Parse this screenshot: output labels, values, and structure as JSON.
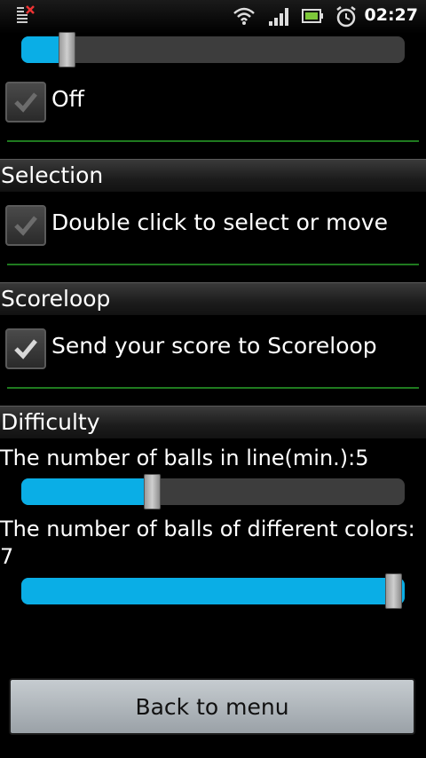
{
  "statusbar": {
    "time": "02:27",
    "icons": [
      "notification-icon",
      "wifi-icon",
      "signal-icon",
      "battery-icon",
      "alarm-icon"
    ]
  },
  "top_slider": {
    "value": 0.12
  },
  "sound": {
    "checkbox_label": "Off",
    "checked": true
  },
  "selection": {
    "header": "Selection",
    "checkbox_label": "Double click to select or move",
    "checked": true
  },
  "scoreloop": {
    "header": "Scoreloop",
    "checkbox_label": "Send your score to Scoreloop",
    "checked": true
  },
  "difficulty": {
    "header": "Difficulty",
    "balls_in_line_label": "The number of balls in line(min.):5",
    "balls_in_line_value": 0.36,
    "colors_label_line1": "The number of balls of different colors:",
    "colors_label_line2": "7",
    "colors_value": 1.0
  },
  "back_button": {
    "label": "Back to menu"
  },
  "colors": {
    "accent": "#0aaee6",
    "divider": "#1f7a1f"
  }
}
